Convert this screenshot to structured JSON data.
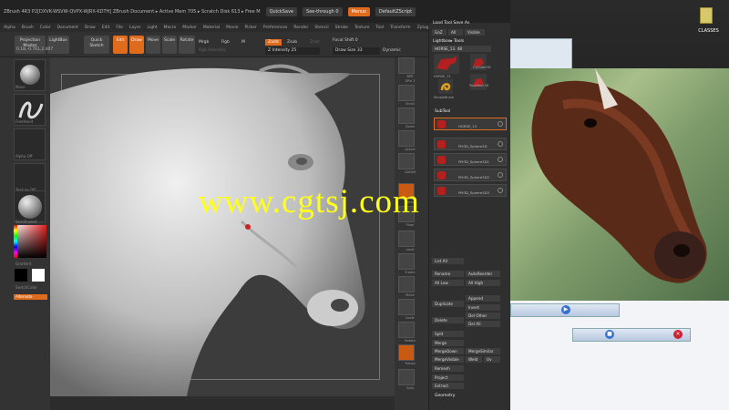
{
  "zbrush": {
    "title": "ZBrush 4R3 P2[DXVK-WSVW-QVPX-WJRX-KDTH]   ZBrush Document   ▸ Active Mem 705 ▸ Scratch Disk 613 ▸ Free M",
    "quicksave": "QuickSave",
    "see_through": "See-through 0",
    "menus": "Menus",
    "default_zscript": "DefaultZScript",
    "menubar": [
      "Alpha",
      "Brush",
      "Color",
      "Document",
      "Draw",
      "Edit",
      "File",
      "Layer",
      "Light",
      "Macro",
      "Marker",
      "Material",
      "Movie",
      "Picker",
      "Preferences",
      "Render",
      "Stencil",
      "Stroke",
      "Texture",
      "Tool",
      "Transform",
      "Zplugin",
      "Zscript"
    ]
  },
  "toolbar": {
    "projection_master": "Projection Master",
    "lightbox": "LightBox",
    "quick_sketch": "Quick Sketch",
    "edit": "Edit",
    "draw": "Draw",
    "move": "Move",
    "scale": "Scale",
    "rotate": "Rotate",
    "mrgb": "Mrgb",
    "rgb": "Rgb",
    "m": "M",
    "zadd": "Zadd",
    "zsub": "Zsub",
    "zcut": "Zcut",
    "rgb_intensity": "Rgb Intensity",
    "z_intensity": "Z Intensity 25",
    "focal_shift": "Focal Shift 0",
    "draw_size": "Draw Size 33",
    "dynamic": "Dynamic",
    "coords": "0.18,-0.761,2.407"
  },
  "left_shelf": {
    "brush_label": "Move",
    "stroke_label": "FreeHand",
    "alpha_label": "Alpha Off",
    "texture_label": "Texture Off",
    "material_label": "SkinShade4",
    "gradient_label": "Gradient",
    "switchcolor_label": "SwitchColor",
    "alternate_label": "Alternate"
  },
  "right_shelf": [
    "BPR",
    "SPix 3",
    "Scroll",
    "Zoom",
    "Actual",
    "AAHalf",
    "Persp",
    "Floor",
    "Local",
    "L.Sym",
    "Xyz",
    "Frame",
    "Move",
    "Scale",
    "Rotate",
    "PolyF",
    "Transp",
    "Ghost",
    "Solo",
    "Xpose"
  ],
  "palette": {
    "header": "Load Tool  Save As",
    "goz": "GoZ",
    "all": "All",
    "visible": "Visible",
    "lightbox_tools": "Lightbox▸ Tools",
    "current_tool": "HORSE_13. 48",
    "tool_thumbs": [
      "HORSE_13",
      "Cylinder3D",
      "SimpleBrush",
      "PolyMesh3D"
    ],
    "subtool_header": "SubTool",
    "subtools": [
      "HORSE_13",
      "PM3D_Sphere3D",
      "PM3D_Sphere3D1",
      "PM3D_Sphere3D2",
      "PM3D_Sphere3D3"
    ],
    "buttons": [
      "List All",
      "Rename",
      "AutoReorder",
      "All Low",
      "All High",
      "Duplicate",
      "Append",
      "Insert",
      "Delete",
      "Del Other",
      "Del All",
      "Split",
      "Merge",
      "MergeDown",
      "MergeSimilar",
      "MergeVisible",
      "Weld",
      "Uv",
      "Remesh",
      "Project",
      "Extract"
    ],
    "footer": "Geometry"
  },
  "desktop": {
    "folder_label": "CLASSES"
  },
  "watermark": "www.cgtsj.com",
  "colors": {
    "accent": "#e06b1c",
    "watermark": "#ffff1a"
  }
}
